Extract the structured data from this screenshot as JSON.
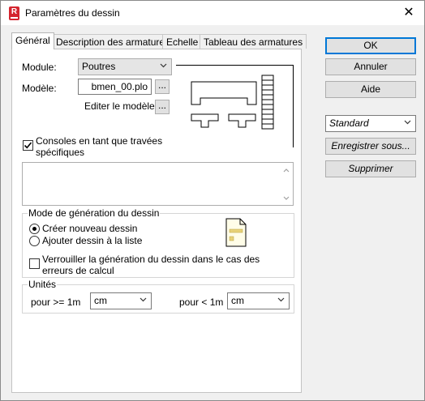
{
  "window": {
    "title": "Paramètres du dessin",
    "close_label": "✕"
  },
  "tabs": [
    {
      "label": "Général"
    },
    {
      "label": "Description des armatures"
    },
    {
      "label": "Echelle"
    },
    {
      "label": "Tableau des armatures"
    }
  ],
  "general": {
    "module_label": "Module:",
    "module_value": "Poutres",
    "template_label": "Modèle:",
    "template_value": "bmen_00.plo",
    "browse_label": "...",
    "edit_template_label": "Editer le modèle:",
    "edit_browse_label": "...",
    "consoles_label": "Consoles en tant que travées spécifiques",
    "consoles_checked": true
  },
  "generation_mode": {
    "title": "Mode de génération du dessin",
    "option_new": "Créer nouveau dessin",
    "option_add": "Ajouter dessin à la liste",
    "selected": "option_new",
    "lock_label": "Verrouiller la génération du dessin dans le cas des erreurs de calcul",
    "lock_checked": false
  },
  "units": {
    "title": "Unités",
    "ge_label": "pour >= 1m",
    "ge_value": "cm",
    "lt_label": "pour < 1m",
    "lt_value": "cm"
  },
  "buttons": {
    "ok": "OK",
    "cancel": "Annuler",
    "help": "Aide",
    "preset_value": "Standard",
    "save_as": "Enregistrer sous...",
    "delete": "Supprimer"
  },
  "icons": {
    "app": "app-r-icon",
    "dropdown": "chevron-down-icon",
    "document": "document-icon"
  }
}
